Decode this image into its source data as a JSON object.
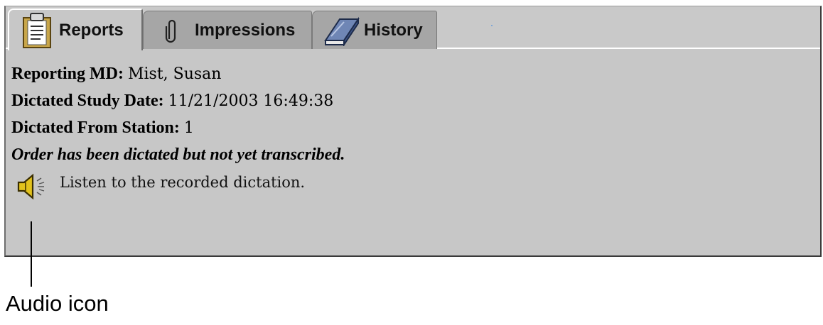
{
  "tabs": [
    {
      "label": "Reports",
      "icon": "clipboard-icon",
      "active": true
    },
    {
      "label": "Impressions",
      "icon": "paperclip-icon",
      "active": false
    },
    {
      "label": "History",
      "icon": "book-icon",
      "active": false
    }
  ],
  "report": {
    "reporting_md_label": "Reporting MD:",
    "reporting_md_value": "Mist, Susan",
    "study_date_label": "Dictated Study Date:",
    "study_date_value": "11/21/2003 16:49:38",
    "station_label": "Dictated From Station:",
    "station_value": "1",
    "status_text": "Order has been dictated but not yet transcribed.",
    "listen_text": "Listen to the recorded dictation."
  },
  "annotation": {
    "label": "Audio icon"
  },
  "colors": {
    "panel": "#c7c7c7",
    "inactive_tab": "#a6a6a6",
    "speaker": "#e2c21c"
  }
}
